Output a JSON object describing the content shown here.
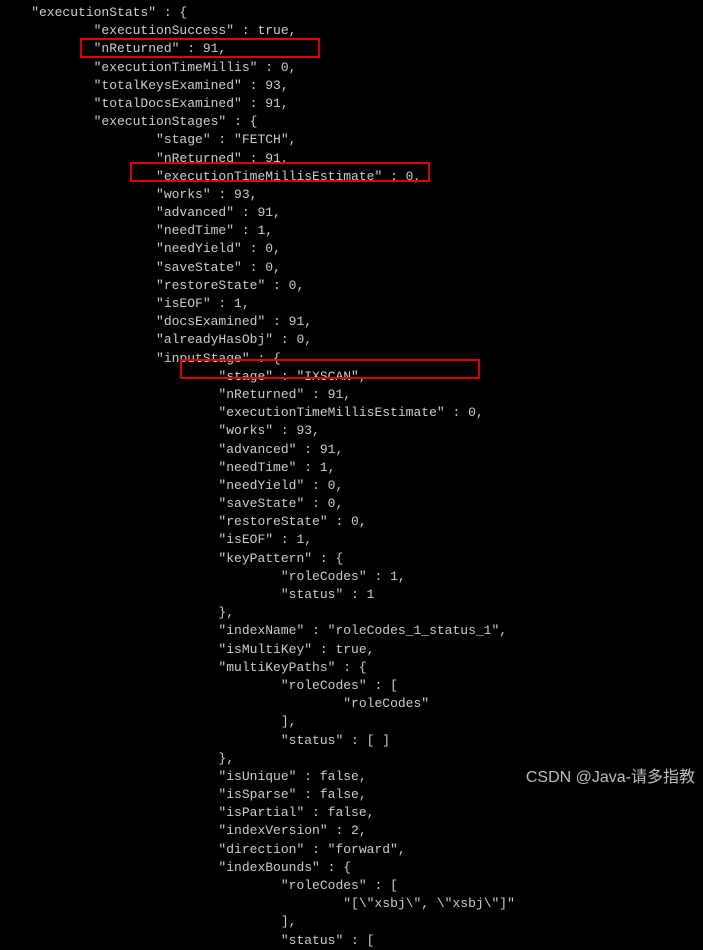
{
  "code_lines": [
    "    \"executionStats\" : {",
    "            \"executionSuccess\" : true,",
    "            \"nReturned\" : 91,",
    "            \"executionTimeMillis\" : 0,",
    "            \"totalKeysExamined\" : 93,",
    "            \"totalDocsExamined\" : 91,",
    "            \"executionStages\" : {",
    "                    \"stage\" : \"FETCH\",",
    "                    \"nReturned\" : 91,",
    "                    \"executionTimeMillisEstimate\" : 0,",
    "                    \"works\" : 93,",
    "                    \"advanced\" : 91,",
    "                    \"needTime\" : 1,",
    "                    \"needYield\" : 0,",
    "                    \"saveState\" : 0,",
    "                    \"restoreState\" : 0,",
    "                    \"isEOF\" : 1,",
    "                    \"docsExamined\" : 91,",
    "                    \"alreadyHasObj\" : 0,",
    "                    \"inputStage\" : {",
    "                            \"stage\" : \"IXSCAN\",",
    "                            \"nReturned\" : 91,",
    "                            \"executionTimeMillisEstimate\" : 0,",
    "                            \"works\" : 93,",
    "                            \"advanced\" : 91,",
    "                            \"needTime\" : 1,",
    "                            \"needYield\" : 0,",
    "                            \"saveState\" : 0,",
    "                            \"restoreState\" : 0,",
    "                            \"isEOF\" : 1,",
    "                            \"keyPattern\" : {",
    "                                    \"roleCodes\" : 1,",
    "                                    \"status\" : 1",
    "                            },",
    "                            \"indexName\" : \"roleCodes_1_status_1\",",
    "                            \"isMultiKey\" : true,",
    "                            \"multiKeyPaths\" : {",
    "                                    \"roleCodes\" : [",
    "                                            \"roleCodes\"",
    "                                    ],",
    "                                    \"status\" : [ ]",
    "                            },",
    "                            \"isUnique\" : false,",
    "                            \"isSparse\" : false,",
    "                            \"isPartial\" : false,",
    "                            \"indexVersion\" : 2,",
    "                            \"direction\" : \"forward\",",
    "                            \"indexBounds\" : {",
    "                                    \"roleCodes\" : [",
    "                                            \"[\\\"xsbj\\\", \\\"xsbj\\\"]\"",
    "                                    ],",
    "                                    \"status\" : ["
  ],
  "watermark": "CSDN @Java-请多指教"
}
